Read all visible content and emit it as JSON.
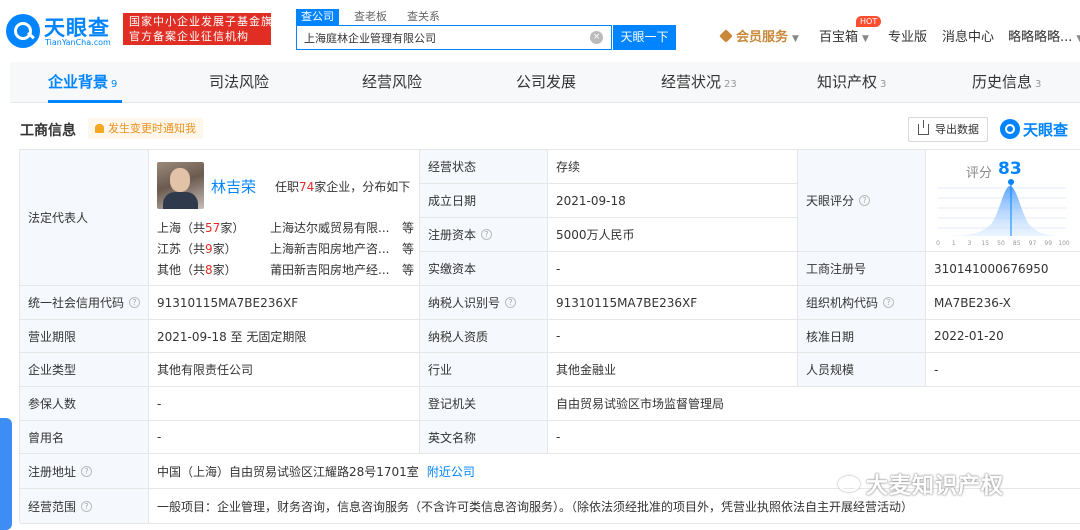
{
  "header": {
    "logo_text": "天眼查",
    "logo_sub": "TianYanCha.com",
    "banner_line1": "国家中小企业发展子基金旗下",
    "banner_line2": "官方备案企业征信机构",
    "search_tabs": [
      "查公司",
      "查老板",
      "查关系"
    ],
    "search_value": "上海庭林企业管理有限公司",
    "search_button": "天眼一下",
    "vip_label": "会员服务",
    "baoxiang_label": "百宝箱",
    "hot_badge": "HOT",
    "pro_label": "专业版",
    "msg_label": "消息中心",
    "user_label": "略略略略..."
  },
  "tabs": [
    {
      "label": "企业背景",
      "count": "9"
    },
    {
      "label": "司法风险",
      "count": ""
    },
    {
      "label": "经营风险",
      "count": ""
    },
    {
      "label": "公司发展",
      "count": ""
    },
    {
      "label": "经营状况",
      "count": "23"
    },
    {
      "label": "知识产权",
      "count": "3"
    },
    {
      "label": "历史信息",
      "count": "3"
    }
  ],
  "section": {
    "title": "工商信息",
    "notify": "发生变更时通知我",
    "export": "导出数据",
    "brand": "天眼查"
  },
  "rep": {
    "label": "法定代表人",
    "name": "林吉荣",
    "desc_pre": "任职",
    "desc_num": "74",
    "desc_post": "家企业，分布如下",
    "rows": [
      {
        "region": "上海",
        "count": "57",
        "company": "上海达尔威贸易有限...",
        "suffix": "等"
      },
      {
        "region": "江苏",
        "count": "9",
        "company": "上海新吉阳房地产咨...",
        "suffix": "等"
      },
      {
        "region": "其他",
        "count": "8",
        "company": "莆田新吉阳房地产经...",
        "suffix": "等"
      }
    ],
    "paren_open": "（共",
    "paren_close": "家）"
  },
  "fields": {
    "status_label": "经营状态",
    "status_value": "存续",
    "founded_label": "成立日期",
    "founded_value": "2021-09-18",
    "capital_label": "注册资本",
    "capital_value": "5000万人民币",
    "paid_label": "实缴资本",
    "paid_value": "-",
    "score_label": "天眼评分",
    "score_title": "评分",
    "score_value": "83",
    "regno_label": "工商注册号",
    "regno_value": "310141000676950",
    "credit_label": "统一社会信用代码",
    "credit_value": "91310115MA7BE236XF",
    "taxid_label": "纳税人识别号",
    "taxid_value": "91310115MA7BE236XF",
    "orgcode_label": "组织机构代码",
    "orgcode_value": "MA7BE236-X",
    "term_label": "营业期限",
    "term_value": "2021-09-18 至 无固定期限",
    "taxqual_label": "纳税人资质",
    "taxqual_value": "-",
    "approve_label": "核准日期",
    "approve_value": "2022-01-20",
    "type_label": "企业类型",
    "type_value": "其他有限责任公司",
    "industry_label": "行业",
    "industry_value": "其他金融业",
    "staff_label": "人员规模",
    "staff_value": "-",
    "insured_label": "参保人数",
    "insured_value": "-",
    "authority_label": "登记机关",
    "authority_value": "自由贸易试验区市场监督管理局",
    "formername_label": "曾用名",
    "formername_value": "-",
    "engname_label": "英文名称",
    "engname_value": "-",
    "address_label": "注册地址",
    "address_value": "中国（上海）自由贸易试验区江耀路28号1701室",
    "address_link": "附近公司",
    "scope_label": "经营范围",
    "scope_value": "一般项目：企业管理，财务咨询，信息咨询服务（不含许可类信息咨询服务）。（除依法须经批准的项目外，凭营业执照依法自主开展经营活动）"
  },
  "score_chart": {
    "ticks": [
      "0",
      "1",
      "3",
      "15",
      "50",
      "85",
      "97",
      "99",
      "100"
    ]
  },
  "watermark": "大麦知识产权",
  "colors": {
    "accent": "#0084ff",
    "danger": "#e02e24",
    "vip": "#c8883a"
  }
}
